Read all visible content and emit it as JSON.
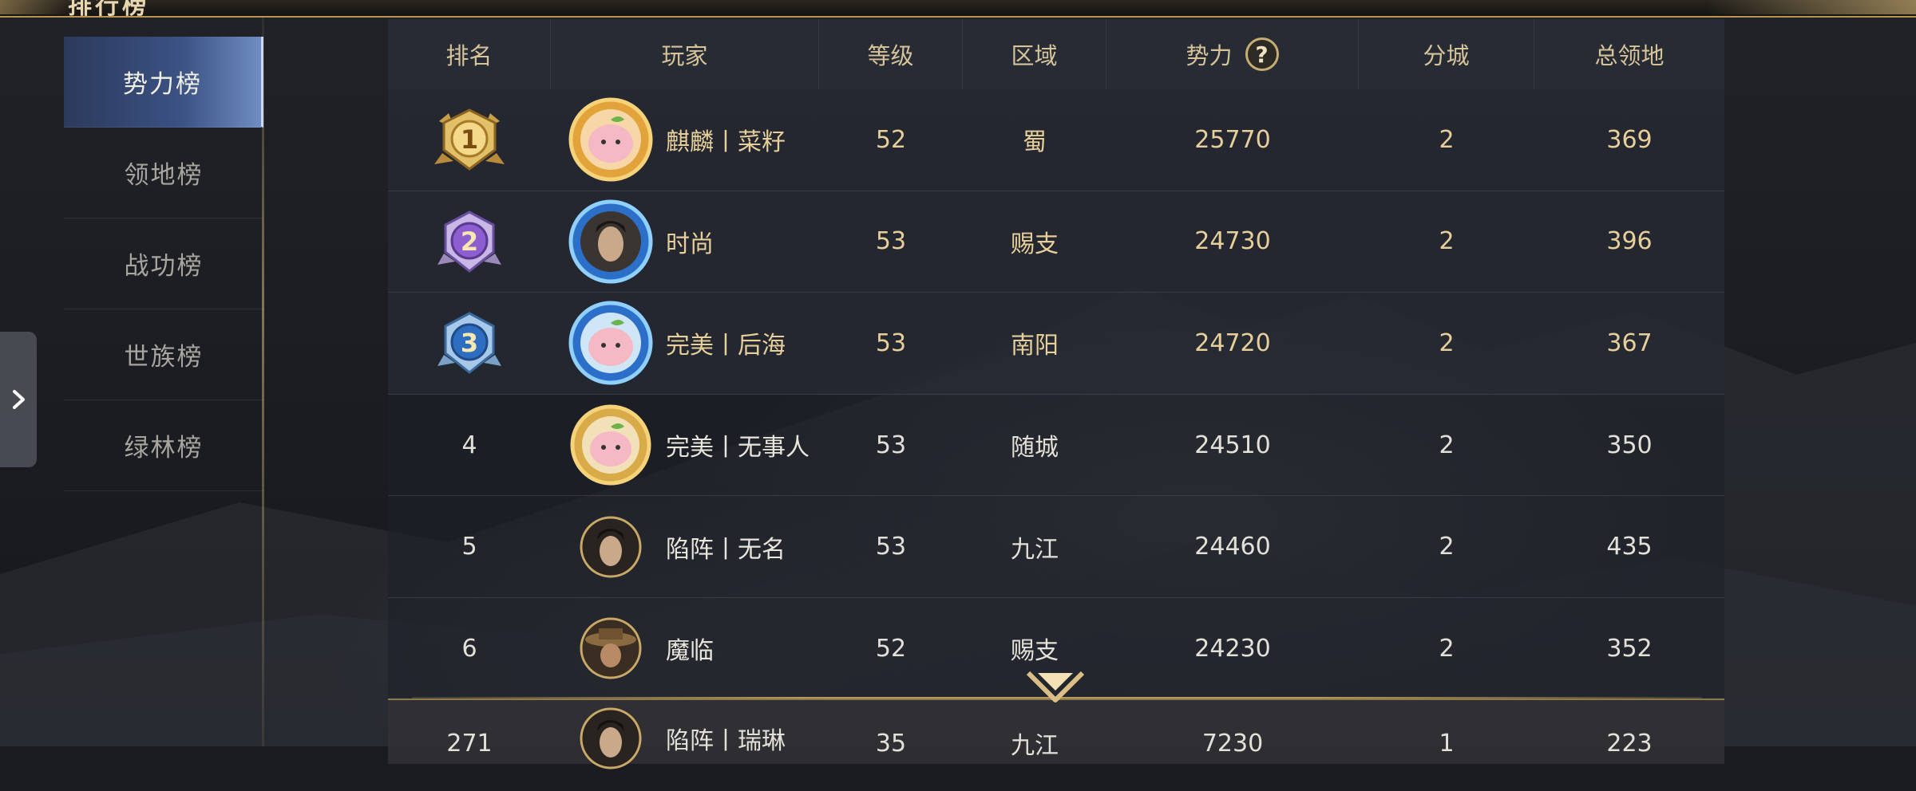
{
  "header": {
    "title": "排行榜"
  },
  "sidebar": {
    "items": [
      {
        "label": "势力榜",
        "active": true
      },
      {
        "label": "领地榜",
        "active": false
      },
      {
        "label": "战功榜",
        "active": false
      },
      {
        "label": "世族榜",
        "active": false
      },
      {
        "label": "绿林榜",
        "active": false
      }
    ]
  },
  "table": {
    "columns": [
      "排名",
      "玩家",
      "等级",
      "区域",
      "势力",
      "分城",
      "总领地"
    ],
    "help_icon": "?",
    "rows": [
      {
        "rank": "1",
        "rank_badge": "gold-medal-icon",
        "avatar": "peach-avatar-gold-frame",
        "player": "麒麟丨菜籽",
        "level": "52",
        "region": "蜀",
        "power": "25770",
        "branch_cities": "2",
        "territory": "369"
      },
      {
        "rank": "2",
        "rank_badge": "purple-medal-icon",
        "avatar": "warrior-avatar-blue-frame",
        "player": "时尚",
        "level": "53",
        "region": "赐支",
        "power": "24730",
        "branch_cities": "2",
        "territory": "396"
      },
      {
        "rank": "3",
        "rank_badge": "blue-medal-icon",
        "avatar": "peach-avatar-blue-frame",
        "player": "完美丨后海",
        "level": "53",
        "region": "南阳",
        "power": "24720",
        "branch_cities": "2",
        "territory": "367"
      },
      {
        "rank": "4",
        "avatar": "peach-avatar-gold-frame",
        "player": "完美丨无事人",
        "level": "53",
        "region": "随城",
        "power": "24510",
        "branch_cities": "2",
        "territory": "350"
      },
      {
        "rank": "5",
        "avatar": "warrior-avatar",
        "player": "陷阵丨无名",
        "level": "53",
        "region": "九江",
        "power": "24460",
        "branch_cities": "2",
        "territory": "435"
      },
      {
        "rank": "6",
        "avatar": "hat-warrior-avatar",
        "player": "魔临",
        "level": "52",
        "region": "赐支",
        "power": "24230",
        "branch_cities": "2",
        "territory": "352"
      }
    ],
    "self_row": {
      "rank": "271",
      "avatar": "warrior-avatar",
      "player": "陷阵丨瑞琳",
      "level": "35",
      "region": "九江",
      "power": "7230",
      "branch_cities": "1",
      "territory": "223"
    }
  },
  "colors": {
    "accent_gold": "#d6c39a",
    "active_tab": "#3b5284",
    "row_top3_text": "#e6cf9a"
  },
  "icons": {
    "collapse_tab": "chevron-right-icon",
    "scroll_hint": "chevron-down-icon"
  }
}
